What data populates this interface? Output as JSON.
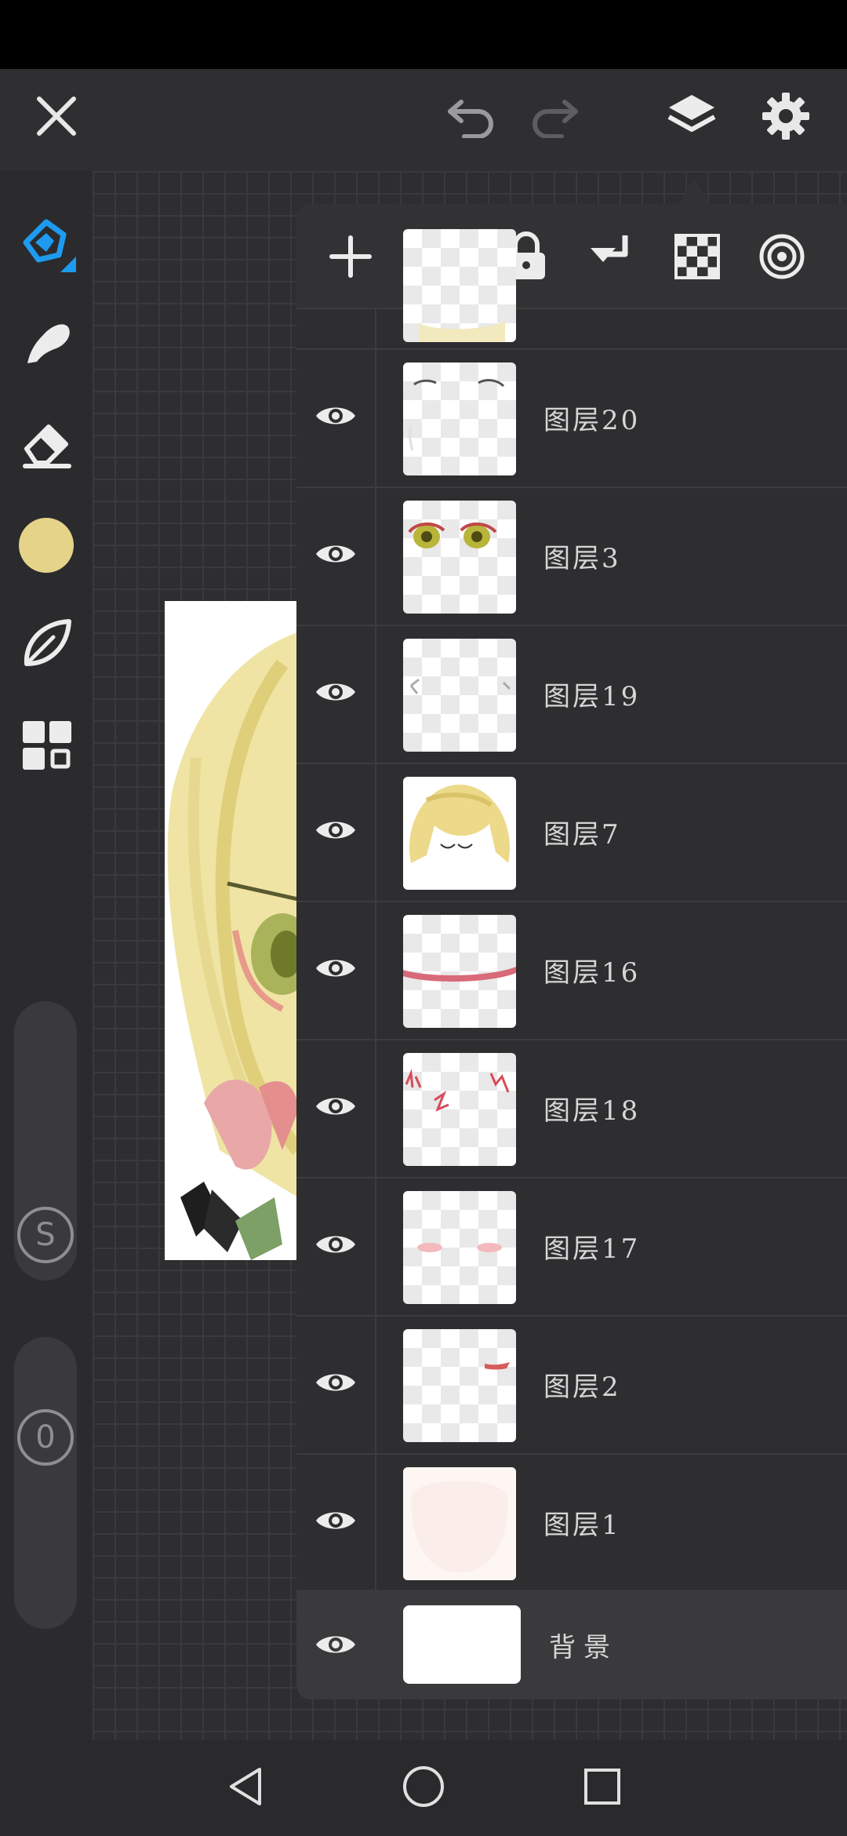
{
  "topbar": {
    "close_icon": "close-icon",
    "undo_icon": "undo-icon",
    "redo_icon": "redo-icon",
    "layers_icon": "layers-icon",
    "settings_icon": "settings-icon"
  },
  "sidebar": {
    "tools": [
      "brush-tool-icon",
      "smudge-tool-icon",
      "eraser-tool-icon",
      "color-swatch",
      "leaf-brush-icon",
      "gallery-icon"
    ],
    "current_color": "#e5d38a",
    "accent_color": "#1e9bf0",
    "size_slider_label": "S",
    "opacity_slider_label": "0"
  },
  "layers_toolbar": [
    "add-layer-icon",
    "folder-icon",
    "lock-icon",
    "merge-down-icon",
    "transparency-icon",
    "target-icon"
  ],
  "layers": [
    {
      "name": "图层20"
    },
    {
      "name": "图层3"
    },
    {
      "name": "图层19"
    },
    {
      "name": "图层7"
    },
    {
      "name": "图层16"
    },
    {
      "name": "图层18"
    },
    {
      "name": "图层17"
    },
    {
      "name": "图层2"
    },
    {
      "name": "图层1"
    }
  ],
  "background_layer": {
    "name": "背景"
  },
  "navbar": [
    "back-icon",
    "home-icon",
    "recents-icon"
  ]
}
